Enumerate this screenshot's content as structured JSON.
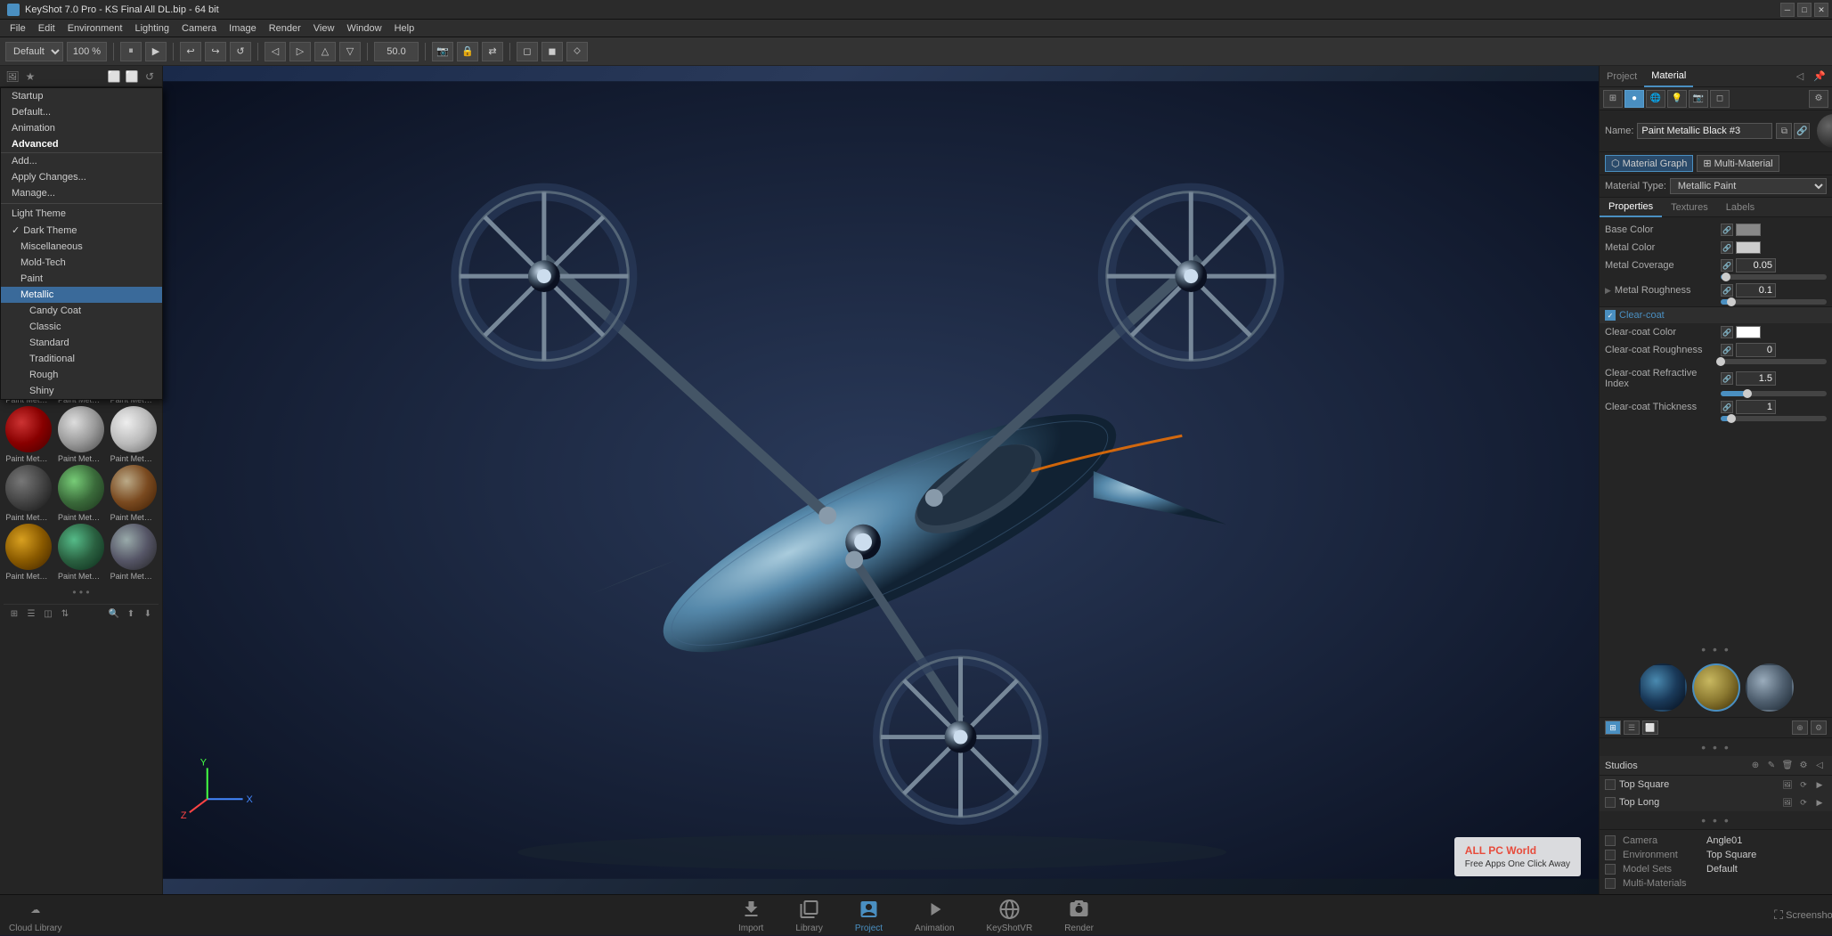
{
  "titlebar": {
    "title": "KeyShot 7.0 Pro - KS Final All DL.bip - 64 bit",
    "icon": "ks",
    "min": "─",
    "max": "□",
    "close": "✕"
  },
  "menubar": {
    "items": [
      "File",
      "Edit",
      "Environment",
      "Lighting",
      "Camera",
      "Image",
      "Render",
      "View",
      "Window",
      "Help"
    ]
  },
  "toolbar": {
    "preset": "Default",
    "zoom": "100 %",
    "frame_num": "50.0"
  },
  "left_panel": {
    "header_icons": [
      "🖼",
      "★"
    ],
    "header_tools": [
      "⬜",
      "⬜",
      "↺"
    ]
  },
  "dropdown": {
    "items": [
      {
        "label": "Startup",
        "indent": 0,
        "type": "normal"
      },
      {
        "label": "Default...",
        "indent": 0,
        "type": "normal"
      },
      {
        "label": "Animation",
        "indent": 0,
        "type": "normal"
      },
      {
        "label": "Advanced",
        "indent": 0,
        "type": "normal",
        "bold": true
      },
      {
        "label": "Add...",
        "indent": 0,
        "type": "separator"
      },
      {
        "label": "Apply Changes...",
        "indent": 0,
        "type": "normal"
      },
      {
        "label": "Manage...",
        "indent": 0,
        "type": "normal"
      },
      {
        "label": "",
        "indent": 0,
        "type": "divider"
      },
      {
        "label": "Light Theme",
        "indent": 0,
        "type": "normal"
      },
      {
        "label": "✓ Dark Theme",
        "indent": 0,
        "type": "checked"
      },
      {
        "label": "Miscellaneous",
        "indent": 1,
        "type": "normal"
      },
      {
        "label": "Mold-Tech",
        "indent": 1,
        "type": "normal"
      },
      {
        "label": "Paint",
        "indent": 1,
        "type": "normal"
      },
      {
        "label": "Metallic",
        "indent": 1,
        "type": "selected"
      },
      {
        "label": "Candy Coat",
        "indent": 2,
        "type": "normal"
      },
      {
        "label": "Classic",
        "indent": 2,
        "type": "normal"
      },
      {
        "label": "Standard",
        "indent": 2,
        "type": "normal"
      },
      {
        "label": "Traditional",
        "indent": 2,
        "type": "normal"
      },
      {
        "label": "Rough",
        "indent": 2,
        "type": "normal"
      },
      {
        "label": "Shiny",
        "indent": 2,
        "type": "normal"
      }
    ]
  },
  "swatches": [
    {
      "label": "Paint Metal...",
      "color": "gold_metallic"
    },
    {
      "label": "Paint Metal...",
      "color": "black_metallic"
    },
    {
      "label": "Paint Metal...",
      "color": "blue_metallic"
    },
    {
      "label": "Paint Metal...",
      "color": "blue_dark"
    },
    {
      "label": "Paint Metal...",
      "color": "green"
    },
    {
      "label": "Paint Metal...",
      "color": "red"
    },
    {
      "label": "Paint Metal...",
      "color": "red2"
    },
    {
      "label": "Paint Metal...",
      "color": "silver"
    },
    {
      "label": "Paint Metal...",
      "color": "silver2"
    },
    {
      "label": "Paint Metal...",
      "color": "dark_silver"
    },
    {
      "label": "Paint Metal...",
      "color": "green2"
    },
    {
      "label": "Paint Metal...",
      "color": "brown"
    },
    {
      "label": "Paint Metal...",
      "color": "gold2"
    },
    {
      "label": "Paint Metal...",
      "color": "green3"
    },
    {
      "label": "Paint Metal...",
      "color": "bronze"
    }
  ],
  "right_panel": {
    "tabs": [
      "Project",
      "Material"
    ],
    "active_tab": "Material",
    "mat_tabs_icons": [
      "grid",
      "sphere",
      "globe",
      "light",
      "camera",
      "rect"
    ],
    "name_label": "Name:",
    "name_value": "Paint Metallic Black #3",
    "material_graph_btn": "Material Graph",
    "multi_material_btn": "Multi-Material",
    "type_label": "Material Type:",
    "type_value": "Metallic Paint",
    "prop_tabs": [
      "Properties",
      "Textures",
      "Labels"
    ],
    "active_prop_tab": "Properties",
    "properties": [
      {
        "label": "Base Color",
        "type": "color_swatch",
        "value": "#888888"
      },
      {
        "label": "Metal Color",
        "type": "color_swatch",
        "value": "#cccccc"
      },
      {
        "label": "Metal Coverage",
        "type": "number",
        "value": "0.05",
        "slider_pct": 5
      },
      {
        "label": "Metal Roughness",
        "type": "expandable_number",
        "value": "0.1",
        "slider_pct": 10,
        "expanded": false
      },
      {
        "label": "Clear-coat",
        "type": "section",
        "checked": true,
        "color": "#4a8fc1"
      },
      {
        "label": "Clear-coat Color",
        "type": "color_swatch",
        "value": "#ffffff"
      },
      {
        "label": "Clear-coat Roughness",
        "type": "number",
        "value": "0",
        "slider_pct": 0
      },
      {
        "label": "Clear-coat Refractive Index",
        "type": "number",
        "value": "1.5",
        "slider_pct": 15
      },
      {
        "label": "Clear-coat Thickness",
        "type": "number",
        "value": "1",
        "slider_pct": 10
      }
    ],
    "preview_balls": [
      "env_ball1",
      "hex_ball2",
      "scene_ball3"
    ],
    "studios": {
      "title": "Studios",
      "items": [
        {
          "label": "Top Square",
          "checked": false
        },
        {
          "label": "Top Long",
          "checked": false
        }
      ]
    },
    "render_settings": {
      "camera_label": "Camera",
      "camera_value": "Angle01",
      "env_label": "Environment",
      "env_value": "Top Square",
      "model_sets_label": "Model Sets",
      "model_sets_value": "Default",
      "multi_materials_label": "Multi-Materials",
      "multi_materials_value": ""
    }
  },
  "bottom_bar": {
    "left_item": {
      "icon": "☁",
      "label": "Cloud Library"
    },
    "tabs": [
      {
        "icon": "⬇",
        "label": "Import"
      },
      {
        "icon": "📚",
        "label": "Library"
      },
      {
        "icon": "📋",
        "label": "Project",
        "active": true
      },
      {
        "icon": "▶",
        "label": "Animation"
      },
      {
        "icon": "🎯",
        "label": "KeyShotVR"
      },
      {
        "icon": "🎬",
        "label": "Render"
      }
    ],
    "right_items": [
      "⛶",
      "🖥"
    ]
  }
}
